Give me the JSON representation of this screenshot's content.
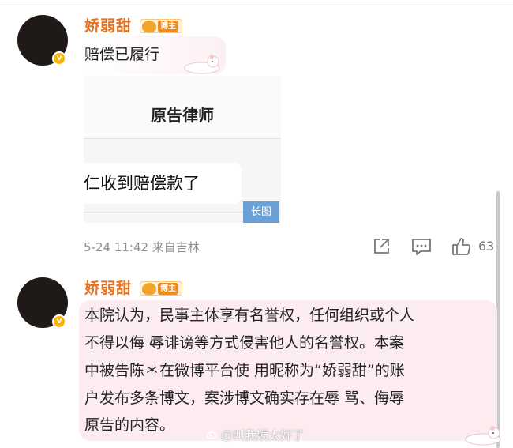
{
  "comments": [
    {
      "username": "娇弱甜",
      "badge_label": "博主",
      "text": "赔偿已履行",
      "image": {
        "title": "原告律师",
        "card_text": "仁收到赔偿款了",
        "tag": "长图"
      },
      "meta": "5-24 11:42 来自吉林",
      "like_count": "63"
    },
    {
      "username": "娇弱甜",
      "badge_label": "博主",
      "lines": [
        "本院认为，民事主体享有名誉权，任何组织或个人",
        "不得以侮 辱诽谤等方式侵害他人的名誉权。本案",
        "中被告陈＊在微博平台使 用昵称为“娇弱甜”的账",
        "户发布多条博文，案涉博文确实存在辱 骂、侮辱",
        "原告的内容。"
      ]
    }
  ],
  "watermark": "@叫我姨太好了",
  "colors": {
    "username": "#e8711f",
    "verified": "#f7b500",
    "bubble": "#fdecef",
    "long_image_tag": "#6aa0d8"
  }
}
